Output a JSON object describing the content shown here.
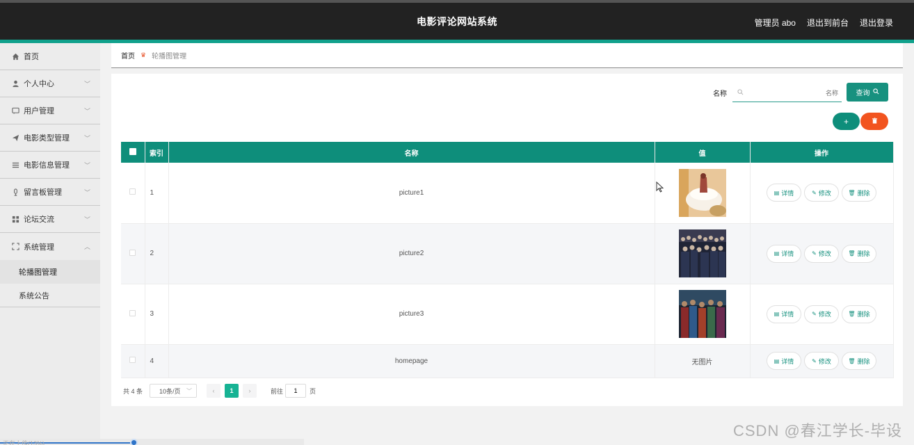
{
  "header": {
    "title": "电影评论网站系统",
    "admin_label": "管理员 abo",
    "back_front": "退出到前台",
    "logout": "退出登录"
  },
  "sidebar": {
    "items": [
      {
        "label": "首页",
        "icon": "home-icon"
      },
      {
        "label": "个人中心",
        "icon": "user-icon"
      },
      {
        "label": "用户管理",
        "icon": "chat-icon"
      },
      {
        "label": "电影类型管理",
        "icon": "send-icon"
      },
      {
        "label": "电影信息管理",
        "icon": "list-icon"
      },
      {
        "label": "留言板管理",
        "icon": "microphone-icon"
      },
      {
        "label": "论坛交流",
        "icon": "grid-icon"
      },
      {
        "label": "系统管理",
        "icon": "fullscreen-icon"
      }
    ],
    "sub_items": [
      {
        "label": "轮播图管理",
        "active": true
      },
      {
        "label": "系统公告",
        "active": false
      }
    ]
  },
  "breadcrumb": {
    "home": "首页",
    "current": "轮播图管理"
  },
  "search": {
    "label": "名称",
    "placeholder": "名称",
    "button": "查询"
  },
  "table": {
    "headers": [
      "索引",
      "名称",
      "值",
      "操作"
    ],
    "rows": [
      {
        "index": "1",
        "name": "picture1",
        "value": "",
        "image": "thumb-1"
      },
      {
        "index": "2",
        "name": "picture2",
        "value": "",
        "image": "thumb-2"
      },
      {
        "index": "3",
        "name": "picture3",
        "value": "",
        "image": "thumb-3"
      },
      {
        "index": "4",
        "name": "homepage",
        "value": "无图片",
        "image": null
      }
    ],
    "actions": {
      "detail": "详情",
      "edit": "修改",
      "delete": "删除"
    }
  },
  "pagination": {
    "total": "共 4 条",
    "page_size": "10条/页",
    "current_page": "1",
    "goto_label": "前往",
    "goto_value": "1",
    "page_suffix": "页"
  },
  "colors": {
    "accent": "#0e8e7b",
    "danger": "#f2541f",
    "header_bg": "#222222"
  },
  "status_bar": {
    "text": "正在上传(13%)"
  },
  "watermark": "CSDN @春江学长-毕设"
}
